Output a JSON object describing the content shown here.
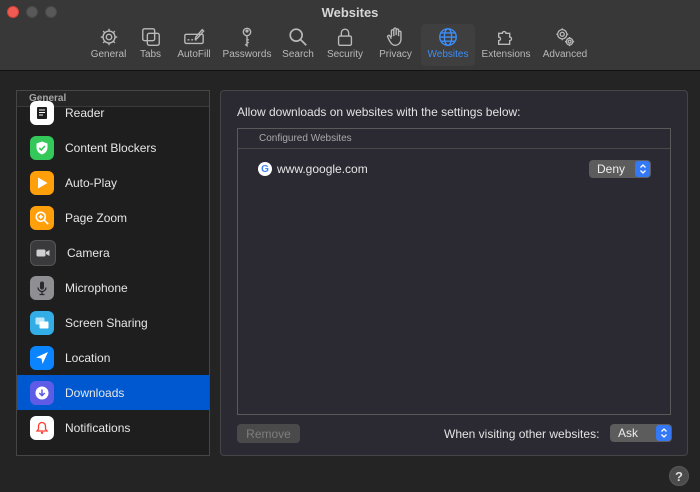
{
  "window": {
    "title": "Websites"
  },
  "toolbar": {
    "tabs": [
      {
        "label": "General",
        "icon": "gear-icon"
      },
      {
        "label": "Tabs",
        "icon": "tabs-icon"
      },
      {
        "label": "AutoFill",
        "icon": "pencil-form-icon"
      },
      {
        "label": "Passwords",
        "icon": "key-icon"
      },
      {
        "label": "Search",
        "icon": "magnifier-icon"
      },
      {
        "label": "Security",
        "icon": "lock-icon"
      },
      {
        "label": "Privacy",
        "icon": "hand-icon"
      },
      {
        "label": "Websites",
        "icon": "globe-icon"
      },
      {
        "label": "Extensions",
        "icon": "puzzle-icon"
      },
      {
        "label": "Advanced",
        "icon": "gears-icon"
      }
    ],
    "active_tab": "Websites",
    "accent_color": "#3d8df6"
  },
  "sidebar": {
    "section": "General",
    "items": [
      {
        "label": "Reader",
        "icon": "reader-icon",
        "color": "#ffffff"
      },
      {
        "label": "Content Blockers",
        "icon": "shield-check-icon",
        "color": "#34c759"
      },
      {
        "label": "Auto-Play",
        "icon": "play-icon",
        "color": "#ff9f0a"
      },
      {
        "label": "Page Zoom",
        "icon": "zoom-icon",
        "color": "#ff9f0a"
      },
      {
        "label": "Camera",
        "icon": "camera-icon",
        "color": "#3a3a3c"
      },
      {
        "label": "Microphone",
        "icon": "microphone-icon",
        "color": "#8e8e93"
      },
      {
        "label": "Screen Sharing",
        "icon": "screen-sharing-icon",
        "color": "#32ade6"
      },
      {
        "label": "Location",
        "icon": "location-arrow-icon",
        "color": "#0a84ff"
      },
      {
        "label": "Downloads",
        "icon": "download-icon",
        "color": "#5e5ce6"
      },
      {
        "label": "Notifications",
        "icon": "bell-icon",
        "color": "#ffffff"
      }
    ],
    "selected": "Downloads",
    "selection_color": "#0058d0"
  },
  "panel": {
    "heading": "Allow downloads on websites with the settings below:",
    "table_header": "Configured Websites",
    "rows": [
      {
        "site": "www.google.com",
        "setting": "Deny",
        "favicon": "google-g-icon"
      }
    ],
    "remove_label": "Remove",
    "other_label": "When visiting other websites:",
    "other_setting": "Ask"
  },
  "help": {
    "label": "?"
  }
}
